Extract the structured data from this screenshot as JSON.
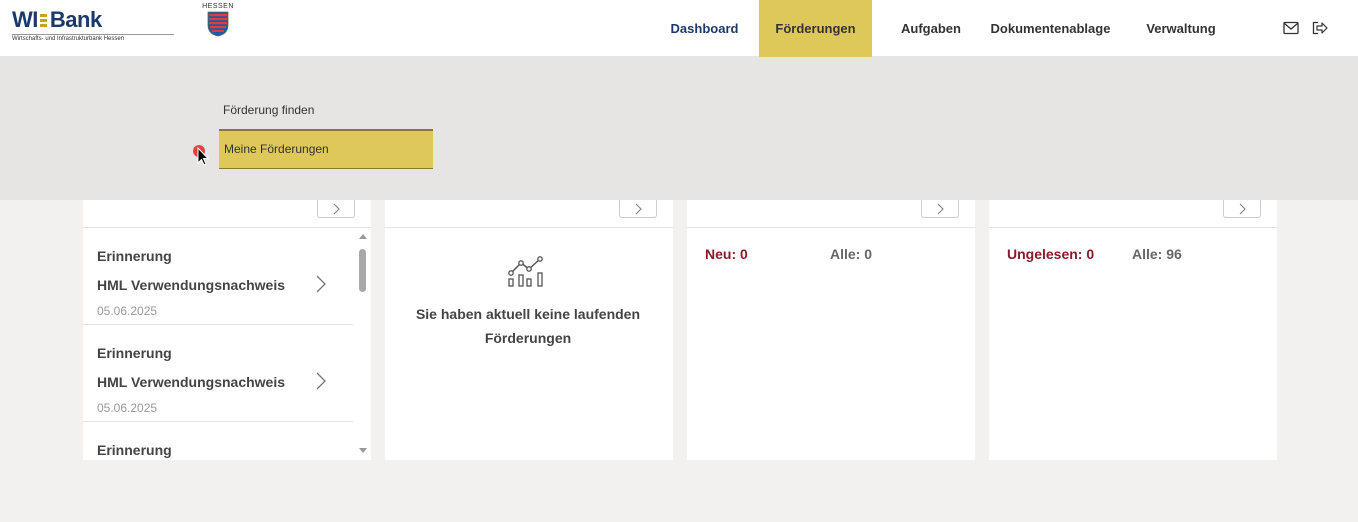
{
  "brand": {
    "name_left": "WI",
    "name_right": "Bank",
    "subtitle": "Wirtschafts- und Infrastrukturbank Hessen",
    "state_label": "HESSEN"
  },
  "nav": {
    "items": [
      {
        "label": "Dashboard"
      },
      {
        "label": "Förderungen"
      },
      {
        "label": "Aufgaben"
      },
      {
        "label": "Dokumentenablage"
      },
      {
        "label": "Verwaltung"
      }
    ],
    "active": "Förderungen",
    "icons": [
      "mail-icon",
      "logout-icon"
    ]
  },
  "dropdown": {
    "items": [
      {
        "label": "Förderung finden"
      },
      {
        "label": "Meine Förderungen"
      }
    ],
    "highlighted": "Meine Förderungen"
  },
  "tasks_card": {
    "items": [
      {
        "title": "Erinnerung",
        "subtitle": "HML Verwendungsnachweis",
        "date": "05.06.2025"
      },
      {
        "title": "Erinnerung",
        "subtitle": "HML Verwendungsnachweis",
        "date": "05.06.2025"
      },
      {
        "title": "Erinnerung"
      }
    ]
  },
  "funding_card": {
    "empty_message": "Sie haben aktuell keine laufenden Förderungen"
  },
  "requests_card": {
    "new_label": "Neu: 0",
    "all_label": "Alle: 0"
  },
  "documents_card": {
    "unread_label": "Ungelesen: 0",
    "all_label": "Alle: 96"
  },
  "colors": {
    "accent": "#dfc85a",
    "brand": "#1b3a6b",
    "status_red": "#8b1a2c"
  }
}
